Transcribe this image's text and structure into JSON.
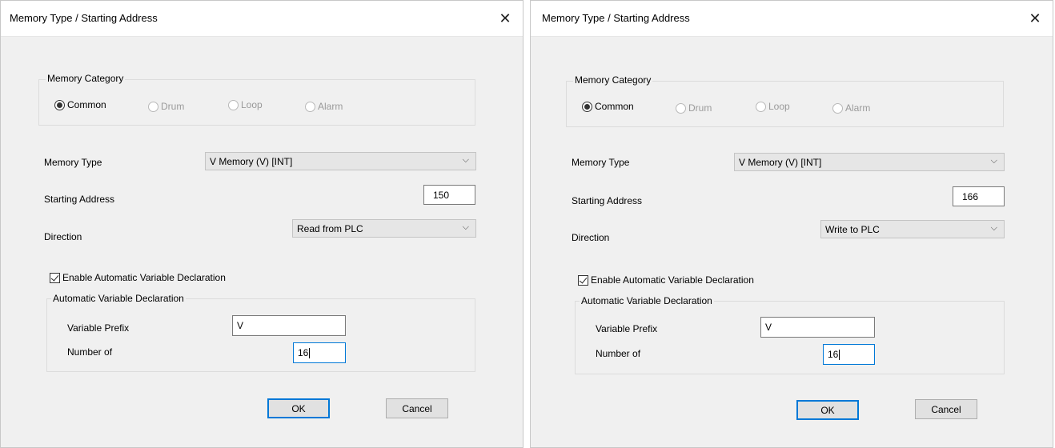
{
  "dialogs": [
    {
      "title": "Memory Type / Starting Address",
      "close_icon": "close-icon",
      "memory_category": {
        "label": "Memory Category",
        "options": [
          "Common",
          "Drum",
          "Loop",
          "Alarm"
        ],
        "selected": "Common"
      },
      "memory_type": {
        "label": "Memory Type",
        "value": "V Memory (V) [INT]"
      },
      "starting_address": {
        "label": "Starting Address",
        "value": "150"
      },
      "direction": {
        "label": "Direction",
        "value": "Read from PLC"
      },
      "enable_auto_decl": {
        "label": "Enable Automatic Variable Declaration",
        "checked": true
      },
      "auto_decl": {
        "label": "Automatic Variable Declaration",
        "prefix_label": "Variable Prefix",
        "prefix_value": "V",
        "number_label": "Number of",
        "number_value": "16"
      },
      "ok_label": "OK",
      "cancel_label": "Cancel"
    },
    {
      "title": "Memory Type / Starting Address",
      "close_icon": "close-icon",
      "memory_category": {
        "label": "Memory Category",
        "options": [
          "Common",
          "Drum",
          "Loop",
          "Alarm"
        ],
        "selected": "Common"
      },
      "memory_type": {
        "label": "Memory Type",
        "value": "V Memory (V) [INT]"
      },
      "starting_address": {
        "label": "Starting Address",
        "value": "166"
      },
      "direction": {
        "label": "Direction",
        "value": "Write to PLC"
      },
      "enable_auto_decl": {
        "label": "Enable Automatic Variable Declaration",
        "checked": true
      },
      "auto_decl": {
        "label": "Automatic Variable Declaration",
        "prefix_label": "Variable Prefix",
        "prefix_value": "V",
        "number_label": "Number of",
        "number_value": "16"
      },
      "ok_label": "OK",
      "cancel_label": "Cancel"
    }
  ],
  "colors": {
    "dialog_bg": "#f0f0f0",
    "focus_blue": "#0078d7",
    "disabled_text": "#9a9a9a"
  }
}
